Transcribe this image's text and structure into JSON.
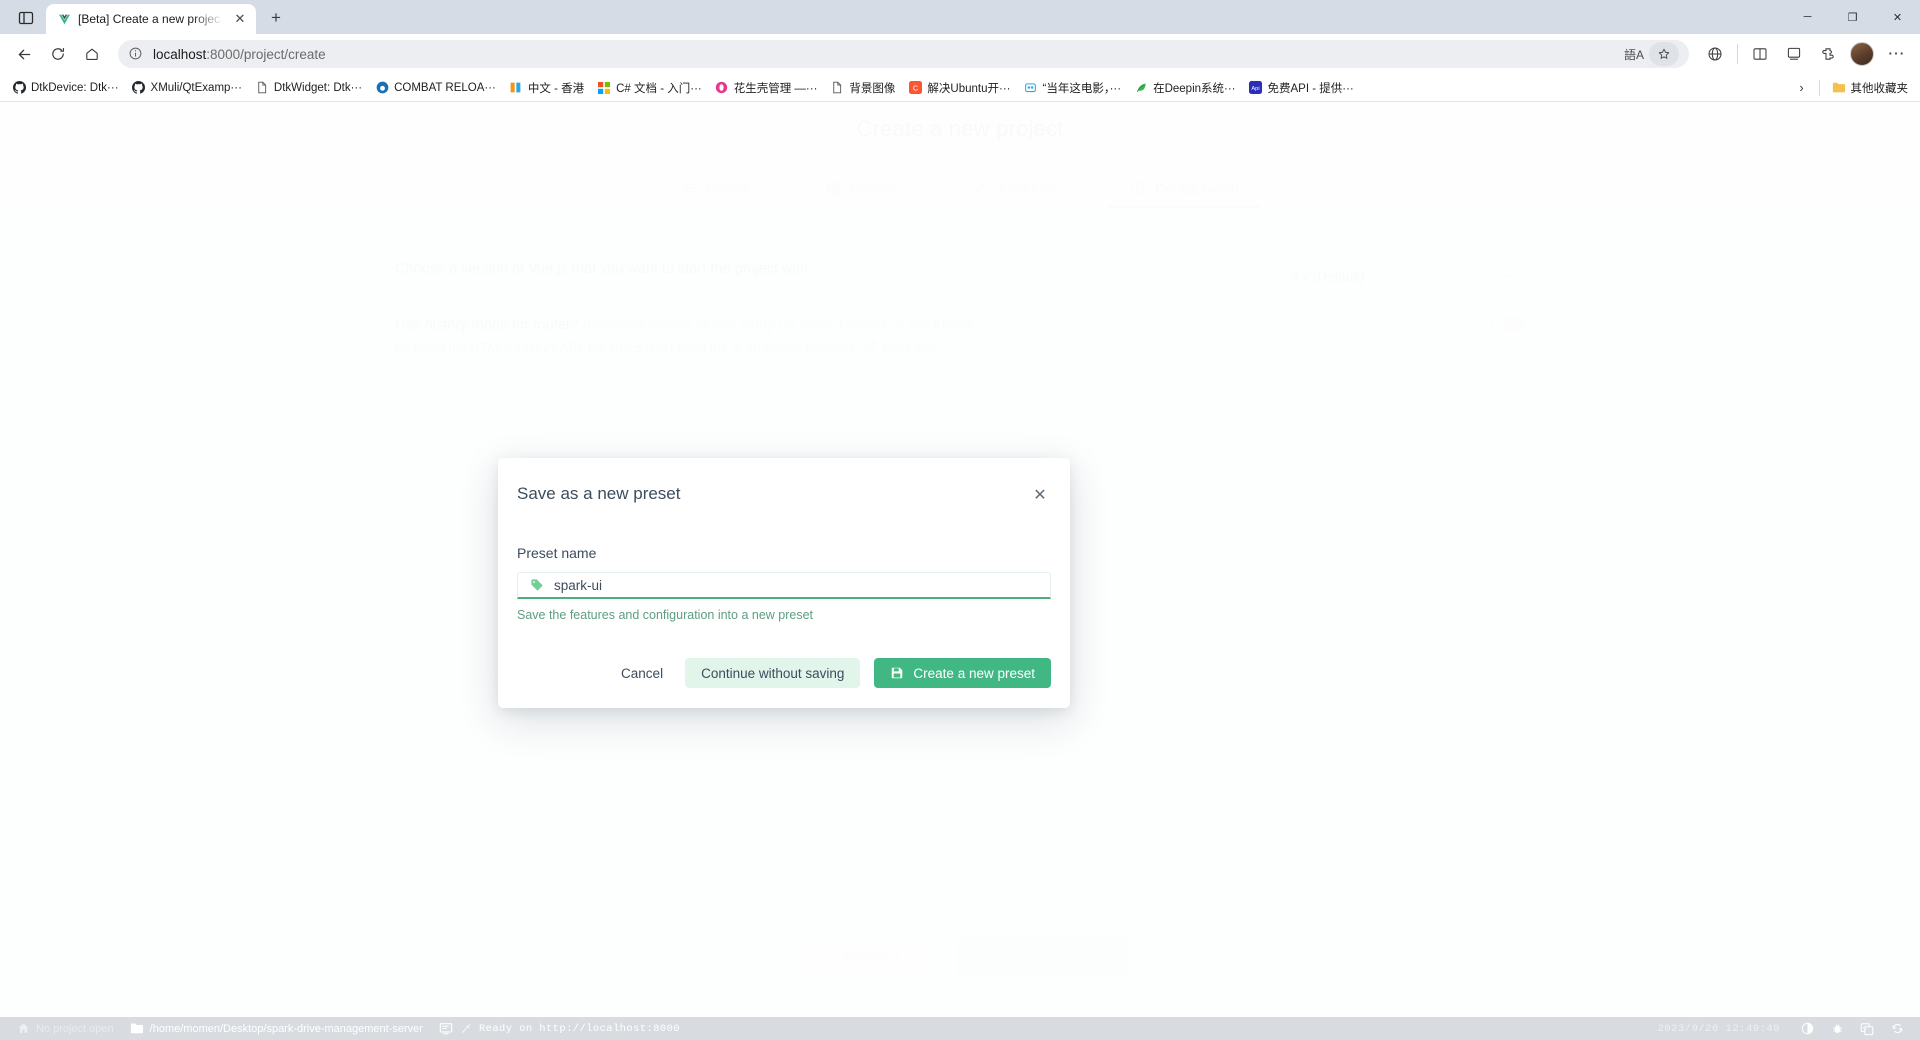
{
  "browser": {
    "tab": {
      "title": "[Beta] Create a new projec",
      "favicon": "vue-logo-icon",
      "close_label": "✕"
    },
    "new_tab_label": "+",
    "window_controls": {
      "minimize": "─",
      "maximize": "❐",
      "close": "✕"
    },
    "toolbar": {
      "back": "←",
      "reload": "↻",
      "home": "home-icon",
      "url_host": "localhost",
      "url_path": ":8000/project/create",
      "translate_label": "語A",
      "favorite_label": "☆",
      "collections_label": "collections-icon",
      "browser_essentials_label": "essentials-icon",
      "extensions_label": "extensions-icon",
      "settings_label": "⋯"
    },
    "bookmarks": [
      {
        "label": "DtkDevice: Dtk···",
        "icon": "github-icon"
      },
      {
        "label": "XMuli/QtExamp···",
        "icon": "github-icon"
      },
      {
        "label": "DtkWidget: Dtk···",
        "icon": "doc-icon"
      },
      {
        "label": "COMBAT RELOA···",
        "icon": "circle-icon"
      },
      {
        "label": "中文 - 香港",
        "icon": "it-icon"
      },
      {
        "label": "C# 文档 - 入门···",
        "icon": "microsoft-icon"
      },
      {
        "label": "花生壳管理 —···",
        "icon": "oray-icon"
      },
      {
        "label": "背景图像",
        "icon": "doc-icon"
      },
      {
        "label": "解决Ubuntu开···",
        "icon": "csdn-icon"
      },
      {
        "label": "“当年这电影，···",
        "icon": "douban-icon"
      },
      {
        "label": "在Deepin系统···",
        "icon": "leaf-icon"
      },
      {
        "label": "免费API - 提供···",
        "icon": "api-icon"
      }
    ],
    "bookmarks_overflow_label": "›",
    "other_bookmarks": {
      "label": "其他收藏夹",
      "icon": "folder-icon"
    }
  },
  "page": {
    "title": "Create a new project",
    "tabs": [
      {
        "label": "Details",
        "icon": "list-icon",
        "active": false
      },
      {
        "label": "Presets",
        "icon": "check-circle-icon",
        "active": false
      },
      {
        "label": "Features",
        "icon": "sitemap-icon",
        "active": false
      },
      {
        "label": "Configuration",
        "icon": "settings-icon",
        "active": true
      }
    ],
    "rows": [
      {
        "label": "Choose a version of Vue.js that you want to start the project with",
        "control": "select",
        "value": "3.x (Default)"
      },
      {
        "label": "Use history mode for router?",
        "warning": "(Requires proper server setup for index fallback in production)",
        "sub": "By using the HTML5 History API, the URLs don't need the '#' character anymore.",
        "link": "More Info",
        "control": "toggle",
        "toggle_on": false
      }
    ],
    "footer": {
      "previous_label": "Previous",
      "previous_icon": "←",
      "create_label": "Create Project",
      "create_icon": "✓"
    }
  },
  "modal": {
    "title": "Save as a new preset",
    "close_label": "✕",
    "field_label": "Preset name",
    "input_value": "spark-ui",
    "input_placeholder": "Preset name",
    "input_icon": "tag-icon",
    "help_text": "Save the features and configuration into a new preset",
    "buttons": {
      "cancel": "Cancel",
      "continue": "Continue without saving",
      "create": "Create a new preset",
      "create_icon": "save-icon"
    }
  },
  "statusbar": {
    "project_status": "No project open",
    "project_icon": "home-icon",
    "path": "/home/momen/Desktop/spark-drive-management-server",
    "path_icon": "folder-icon",
    "terminal_icon": "terminal-icon",
    "server_status": "Ready on http://localhost:8000",
    "datetime": "2023/9/26  12:49:40",
    "tray": [
      "contrast-icon",
      "bug-icon",
      "translate-icon",
      "sync-icon"
    ]
  },
  "colors": {
    "accent_green": "#41b883",
    "accent_purple": "#b07ede",
    "warning": "#e8a33d"
  }
}
